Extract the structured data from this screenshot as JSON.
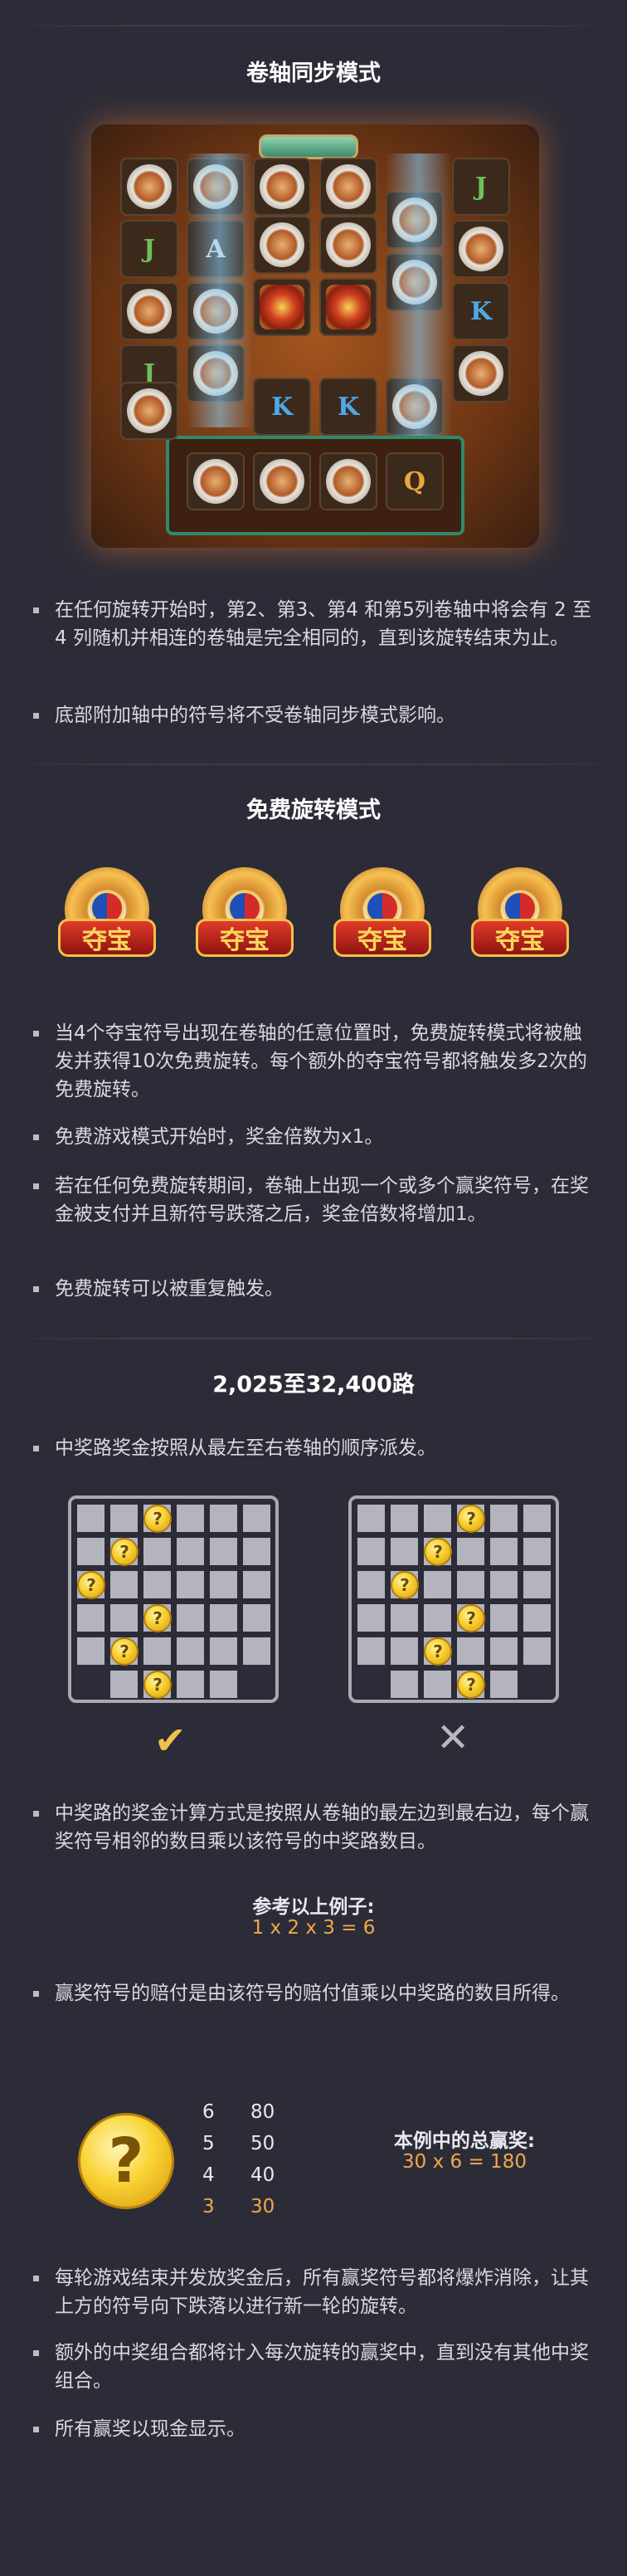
{
  "reel_sync": {
    "title": "卷轴同步模式",
    "bullets": [
      "在任何旋转开始时，第2、第3、第4 和第5列卷轴中将会有 2 至 4 列随机并相连的卷轴是完全相同的，直到该旋转结束为止。",
      "底部附加轴中的符号将不受卷轴同步模式影响。"
    ],
    "symbols": [
      "J",
      "A",
      "K",
      "K",
      "J",
      "J",
      "K",
      "Q"
    ]
  },
  "free_spins": {
    "title": "免费旋转模式",
    "scatter_label": "夺宝",
    "bullets": [
      "当4个夺宝符号出现在卷轴的任意位置时，免费旋转模式将被触发并获得10次免费旋转。每个额外的夺宝符号都将触发多2次的免费旋转。",
      "免费游戏模式开始时，奖金倍数为x1。",
      "若在任何免费旋转期间，卷轴上出现一个或多个赢奖符号，在奖金被支付并且新符号跌落之后，奖金倍数将增加1。",
      "免费旋转可以被重复触发。"
    ]
  },
  "ways": {
    "title": "2,025至32,400路",
    "bullets": [
      "中奖路奖金按照从最左至右卷轴的顺序派发。",
      "中奖路的奖金计算方式是按照从卷轴的最左边到最右边，每个赢奖符号相邻的数目乘以该符号的中奖路数目。",
      "赢奖符号的赔付是由该符号的赔付值乘以中奖路的数目所得。",
      "每轮游戏结束并发放奖金后，所有赢奖符号都将爆炸消除，让其上方的符号向下跌落以进行新一轮的旋转。",
      "额外的中奖组合都将计入每次旋转的赢奖中，直到没有其他中奖组合。",
      "所有赢奖以现金显示。"
    ],
    "example_title": "参考以上例子:",
    "example_formula": "1 x 2 x 3 = 6",
    "valid_mark": "✔",
    "invalid_mark": "✕",
    "coin_symbol": "?",
    "paytable": [
      {
        "count": "6",
        "value": "80"
      },
      {
        "count": "5",
        "value": "50"
      },
      {
        "count": "4",
        "value": "40"
      },
      {
        "count": "3",
        "value": "30"
      }
    ],
    "total_title": "本例中的总赢奖:",
    "total_formula": "30 x 6 = 180",
    "colors": {
      "accent": "#f0a84a",
      "check": "#f2c14a",
      "cross": "#b8b8c2"
    }
  }
}
